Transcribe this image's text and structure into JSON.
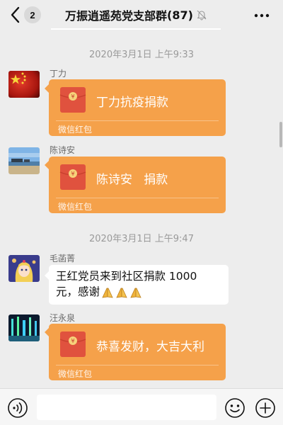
{
  "header": {
    "back_icon": "chevron-left-icon",
    "unread_count": "2",
    "title": "万振逍遥苑党支部群",
    "member_count": "(87)",
    "mute_icon": "bell-off-icon",
    "more_icon": "more-dots-icon"
  },
  "messages": [
    {
      "type": "timestamp",
      "text": "2020年3月1日 上午9:33"
    },
    {
      "type": "redpacket",
      "sender": "丁力",
      "avatar": "avatar-chinese-flag",
      "text": "丁力抗疫捐款",
      "footer": "微信红包"
    },
    {
      "type": "redpacket",
      "sender": "陈诗安",
      "avatar": "avatar-seaside-landscape",
      "text": "陈诗安   捐款",
      "footer": "微信红包"
    },
    {
      "type": "timestamp",
      "text": "2020年3月1日 上午9:47"
    },
    {
      "type": "text",
      "sender": "毛菡菁",
      "avatar": "avatar-anime-girl",
      "line1": "王红党员来到社区捐款 1000",
      "line2": "元，感谢",
      "emoji": [
        "praying-hands-emoji",
        "praying-hands-emoji",
        "praying-hands-emoji"
      ]
    },
    {
      "type": "redpacket",
      "sender": "汪永泉",
      "avatar": "avatar-night-fountain",
      "text": "恭喜发财，大吉大利",
      "footer": "微信红包"
    }
  ],
  "input_bar": {
    "voice_icon": "voice-input-icon",
    "input_value": "",
    "emoji_icon": "smiley-face-icon",
    "plus_icon": "plus-circle-icon"
  },
  "colors": {
    "background": "#ededed",
    "redpacket": "#f5a14a",
    "redpacket_icon": "#e0523e",
    "timestamp": "#9a9a9a"
  }
}
